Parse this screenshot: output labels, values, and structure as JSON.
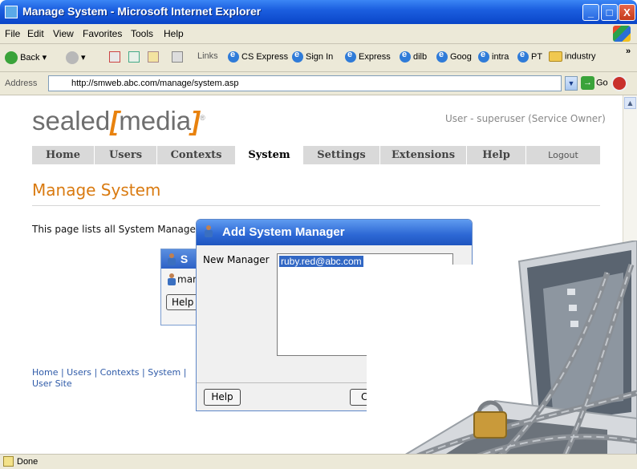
{
  "window": {
    "title": "Manage System - Microsoft Internet Explorer",
    "buttons": {
      "minimize": "_",
      "maximize": "□",
      "close": "X"
    }
  },
  "menu": [
    "File",
    "Edit",
    "View",
    "Favorites",
    "Tools",
    "Help"
  ],
  "toolbar": {
    "back": "Back",
    "links_label": "Links",
    "links": [
      "CS Express",
      "Sign In",
      "Express",
      "dilb",
      "Goog",
      "intra",
      "PT",
      "industry"
    ],
    "overflow": "»"
  },
  "address": {
    "label": "Address",
    "url": "http://smweb.abc.com/manage/system.asp",
    "go": "Go"
  },
  "page": {
    "logo_text": "sealed",
    "logo_bracket_open": "[",
    "logo_media": "media",
    "logo_bracket_close": "]",
    "logo_reg": "®",
    "user_info": "User - superuser (Service Owner)",
    "nav": [
      "Home",
      "Users",
      "Contexts",
      "System",
      "Settings",
      "Extensions",
      "Help",
      "Logout"
    ],
    "active_tab": "System",
    "heading": "Manage System",
    "description": "This page lists all System Manage",
    "panel": {
      "title": "S",
      "row": "mar",
      "button": "Help"
    },
    "footer_line1": "Home | Users | Contexts | System |",
    "footer_line2": "User Site"
  },
  "dialog": {
    "title": "Add System Manager",
    "label": "New Manager",
    "value": "ruby.red@abc.com",
    "help_button": "Help",
    "second_button": "C"
  },
  "status": {
    "text": "Done"
  },
  "colors": {
    "titlebar": "#0a45c8",
    "accent": "#d97a10",
    "dialog_header": "#2c67d4",
    "selection": "#3167c4"
  }
}
